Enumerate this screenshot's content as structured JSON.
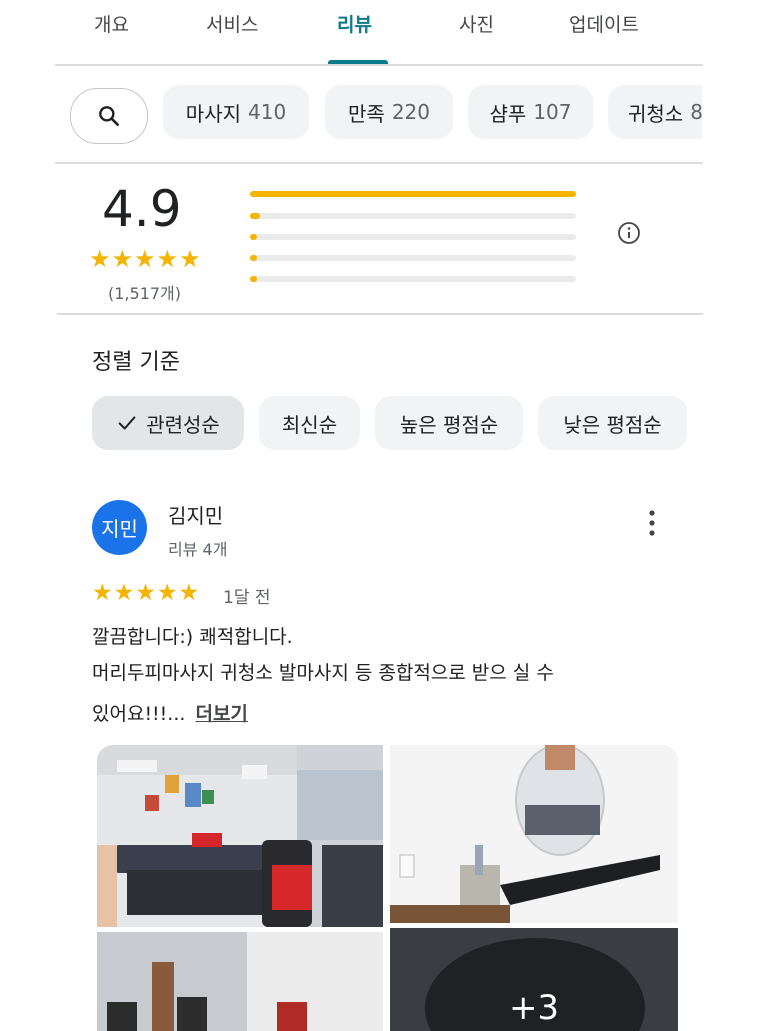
{
  "tabs": [
    {
      "label": "개요"
    },
    {
      "label": "서비스"
    },
    {
      "label": "리뷰"
    },
    {
      "label": "사진"
    },
    {
      "label": "업데이트"
    }
  ],
  "topic_chips": [
    {
      "label": "마사지",
      "count": "410"
    },
    {
      "label": "만족",
      "count": "220"
    },
    {
      "label": "샴푸",
      "count": "107"
    },
    {
      "label": "귀청소",
      "count": "8"
    }
  ],
  "rating": {
    "score": "4.9",
    "stars": "★★★★★",
    "count": "(1,517개)",
    "distribution": [
      {
        "stars": 5,
        "fraction": 1.0
      },
      {
        "stars": 4,
        "fraction": 0.03
      },
      {
        "stars": 3,
        "fraction": 0.008
      },
      {
        "stars": 2,
        "fraction": 0.008
      },
      {
        "stars": 1,
        "fraction": 0.015
      }
    ]
  },
  "sort": {
    "title": "정렬 기준",
    "options": [
      {
        "label": "관련성순",
        "selected": true
      },
      {
        "label": "최신순",
        "selected": false
      },
      {
        "label": "높은 평점순",
        "selected": false
      },
      {
        "label": "낮은 평점순",
        "selected": false
      }
    ]
  },
  "review": {
    "avatar_text": "지민",
    "avatar_color": "#1a73e8",
    "author": "김지민",
    "meta": "리뷰 4개",
    "stars": "★★★★★",
    "time": "1달 전",
    "line1": "깔끔합니다:) 쾌적합니다.",
    "line2": "머리두피마사지 귀청소 발마사지 등 종합적으로 받으 실 수",
    "line3": "있어요!!!...",
    "more": "더보기",
    "more_photos": "+3"
  },
  "colors": {
    "accent": "#0b7a8a",
    "star": "#f4b400",
    "chip_bg": "#f1f3f4"
  }
}
